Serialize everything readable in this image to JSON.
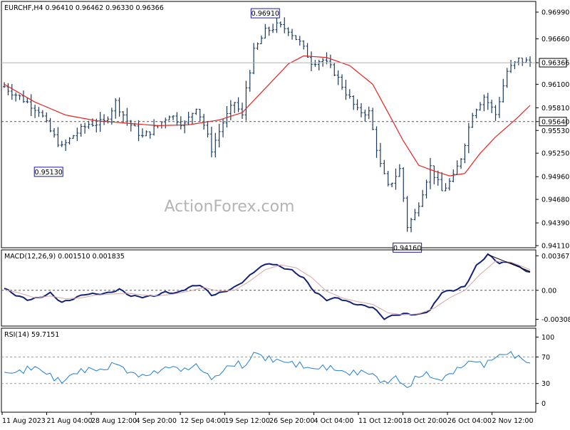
{
  "colors": {
    "background": "#ffffff",
    "border": "#000000",
    "bars": "#1a3a5c",
    "moving_average": "#e8231e",
    "macd_line": "#13217a",
    "macd_signal": "#d6a6a6",
    "rsi_line": "#1f7fd4",
    "trendline": "#000000",
    "dashed_lines": "#555555",
    "label_border": "#1a1aa0"
  },
  "watermark": "ActionForex.com",
  "chart_data": [
    {
      "type": "ohlc",
      "name": "price",
      "header": "EURCHF,H4  0.96410 0.96462 0.96330 0.96366",
      "y_ticks": [
        "0.96990",
        "0.96660",
        "0.96366",
        "0.96100",
        "0.95810",
        "0.95640",
        "0.95530",
        "0.95250",
        "0.94960",
        "0.94680",
        "0.94390",
        "0.94110"
      ],
      "y_tick_values": [
        0.9699,
        0.9666,
        0.96366,
        0.961,
        0.9581,
        0.9564,
        0.9553,
        0.9525,
        0.9496,
        0.9468,
        0.9439,
        0.9411
      ],
      "highlighted_ticks": [
        "0.96366",
        "0.95640"
      ],
      "ylim": [
        0.9411,
        0.9699
      ],
      "current_price": 0.96366,
      "support_level": 0.9564,
      "annotations": [
        {
          "label": "0.96910",
          "value": 0.9691,
          "bar": 68
        },
        {
          "label": "0.95130",
          "value": 0.9513,
          "bar": 16
        },
        {
          "label": "0.94160",
          "value": 0.9416,
          "bar": 105
        }
      ],
      "x_ticks": [
        "11 Aug 2023",
        "21 Aug 04:00",
        "28 Aug 12:00",
        "4 Sep 20:00",
        "12 Sep 04:00",
        "19 Sep 12:00",
        "26 Sep 20:00",
        "4 Oct 04:00",
        "11 Oct 12:00",
        "18 Oct 20:00",
        "26 Oct 04:00",
        "2 Nov 12:00"
      ],
      "close_path": [
        [
          0,
          0.9607
        ],
        [
          5,
          0.9591
        ],
        [
          9,
          0.9578
        ],
        [
          12,
          0.9552
        ],
        [
          15,
          0.9532
        ],
        [
          18,
          0.9547
        ],
        [
          22,
          0.9561
        ],
        [
          26,
          0.9563
        ],
        [
          29,
          0.9588
        ],
        [
          32,
          0.9565
        ],
        [
          36,
          0.9545
        ],
        [
          40,
          0.9559
        ],
        [
          43,
          0.9573
        ],
        [
          47,
          0.956
        ],
        [
          50,
          0.9583
        ],
        [
          52,
          0.956
        ],
        [
          54,
          0.953
        ],
        [
          57,
          0.9563
        ],
        [
          60,
          0.9588
        ],
        [
          62,
          0.957
        ],
        [
          63,
          0.9606
        ],
        [
          65,
          0.965
        ],
        [
          68,
          0.9675
        ],
        [
          71,
          0.9682
        ],
        [
          74,
          0.9678
        ],
        [
          77,
          0.9661
        ],
        [
          80,
          0.9638
        ],
        [
          83,
          0.964
        ],
        [
          86,
          0.9625
        ],
        [
          89,
          0.96
        ],
        [
          92,
          0.9577
        ],
        [
          95,
          0.9575
        ],
        [
          98,
          0.951
        ],
        [
          100,
          0.9483
        ],
        [
          103,
          0.9505
        ],
        [
          105,
          0.9435
        ],
        [
          107,
          0.945
        ],
        [
          109,
          0.9478
        ],
        [
          111,
          0.9508
        ],
        [
          114,
          0.9478
        ],
        [
          117,
          0.9495
        ],
        [
          119,
          0.952
        ],
        [
          122,
          0.9575
        ],
        [
          125,
          0.9595
        ],
        [
          128,
          0.9573
        ],
        [
          131,
          0.9626
        ],
        [
          134,
          0.964
        ],
        [
          137,
          0.9637
        ]
      ],
      "moving_average_path": [
        [
          0,
          0.961
        ],
        [
          8,
          0.9588
        ],
        [
          16,
          0.9572
        ],
        [
          24,
          0.9565
        ],
        [
          32,
          0.9562
        ],
        [
          40,
          0.9559
        ],
        [
          48,
          0.956
        ],
        [
          56,
          0.9566
        ],
        [
          62,
          0.9575
        ],
        [
          68,
          0.9605
        ],
        [
          74,
          0.9635
        ],
        [
          78,
          0.9645
        ],
        [
          84,
          0.9643
        ],
        [
          90,
          0.9633
        ],
        [
          96,
          0.961
        ],
        [
          100,
          0.9575
        ],
        [
          104,
          0.954
        ],
        [
          108,
          0.951
        ],
        [
          112,
          0.9503
        ],
        [
          116,
          0.9497
        ],
        [
          120,
          0.95
        ],
        [
          124,
          0.9525
        ],
        [
          128,
          0.9545
        ],
        [
          134,
          0.957
        ],
        [
          137,
          0.9584
        ]
      ],
      "bar_count": 138
    },
    {
      "type": "line",
      "name": "macd",
      "label": "MACD(12,26,9) 0.001510 0.001835",
      "y_ticks": [
        "0.00367",
        "0.00",
        "-0.00308"
      ],
      "y_tick_values": [
        0.00367,
        0.0,
        -0.00308
      ],
      "ylim": [
        -0.00365,
        0.00392
      ],
      "series": [
        {
          "key": "macd_line",
          "points": [
            [
              0,
              0.0002
            ],
            [
              3,
              -0.0005
            ],
            [
              6,
              -0.001
            ],
            [
              9,
              -0.0008
            ],
            [
              12,
              -0.0003
            ],
            [
              15,
              -0.0013
            ],
            [
              18,
              -0.0009
            ],
            [
              21,
              -0.0004
            ],
            [
              24,
              -0.0004
            ],
            [
              27,
              -0.0003
            ],
            [
              30,
              0.0001
            ],
            [
              33,
              -0.0006
            ],
            [
              36,
              -0.0007
            ],
            [
              39,
              -0.0006
            ],
            [
              42,
              -0.0002
            ],
            [
              45,
              -0.0003
            ],
            [
              48,
              0.0003
            ],
            [
              51,
              0.0006
            ],
            [
              54,
              -0.0005
            ],
            [
              57,
              -0.0002
            ],
            [
              60,
              0.0003
            ],
            [
              63,
              0.0012
            ],
            [
              66,
              0.0023
            ],
            [
              69,
              0.0029
            ],
            [
              72,
              0.0025
            ],
            [
              75,
              0.0021
            ],
            [
              78,
              0.0013
            ],
            [
              81,
              -0.0002
            ],
            [
              84,
              -0.001
            ],
            [
              87,
              -0.0008
            ],
            [
              90,
              -0.0013
            ],
            [
              93,
              -0.0016
            ],
            [
              96,
              -0.0018
            ],
            [
              99,
              -0.003
            ],
            [
              102,
              -0.0026
            ],
            [
              105,
              -0.0025
            ],
            [
              108,
              -0.0026
            ],
            [
              111,
              -0.0021
            ],
            [
              114,
              -0.0002
            ],
            [
              117,
              -0.0
            ],
            [
              120,
              0.0004
            ],
            [
              123,
              0.0026
            ],
            [
              126,
              0.0038
            ],
            [
              129,
              0.0029
            ],
            [
              132,
              0.003
            ],
            [
              134,
              0.0025
            ],
            [
              137,
              0.0019
            ]
          ]
        },
        {
          "key": "macd_signal",
          "points": [
            [
              0,
              0.0001
            ],
            [
              4,
              -0.0003
            ],
            [
              8,
              -0.0008
            ],
            [
              12,
              -0.0006
            ],
            [
              16,
              -0.0009
            ],
            [
              20,
              -0.0008
            ],
            [
              24,
              -0.0005
            ],
            [
              28,
              -0.0004
            ],
            [
              32,
              -0.0003
            ],
            [
              36,
              -0.0005
            ],
            [
              40,
              -0.0006
            ],
            [
              44,
              -0.0004
            ],
            [
              48,
              -0.0001
            ],
            [
              52,
              0.0003
            ],
            [
              56,
              -0.0001
            ],
            [
              60,
              0.0
            ],
            [
              64,
              0.001
            ],
            [
              68,
              0.0022
            ],
            [
              72,
              0.0027
            ],
            [
              76,
              0.0024
            ],
            [
              80,
              0.0014
            ],
            [
              84,
              -0.0001
            ],
            [
              88,
              -0.0008
            ],
            [
              92,
              -0.0012
            ],
            [
              96,
              -0.0015
            ],
            [
              100,
              -0.0024
            ],
            [
              104,
              -0.0026
            ],
            [
              108,
              -0.0025
            ],
            [
              112,
              -0.0019
            ],
            [
              116,
              -0.0008
            ],
            [
              120,
              0.0
            ],
            [
              124,
              0.0017
            ],
            [
              128,
              0.0031
            ],
            [
              132,
              0.003
            ],
            [
              137,
              0.0022
            ]
          ]
        }
      ],
      "trendline": [
        [
          126,
          0.0038
        ],
        [
          137,
          0.002
        ]
      ]
    },
    {
      "type": "line",
      "name": "rsi",
      "label": "RSI(14) 59.7151",
      "y_ticks": [
        "100",
        "70",
        "30",
        "0"
      ],
      "y_tick_values": [
        100,
        70,
        30,
        0
      ],
      "guide_levels": [
        70,
        30
      ],
      "ylim": [
        -10,
        108
      ],
      "series": [
        {
          "key": "rsi_line",
          "points": [
            [
              0,
              45
            ],
            [
              4,
              48
            ],
            [
              8,
              55
            ],
            [
              12,
              42
            ],
            [
              15,
              32
            ],
            [
              18,
              45
            ],
            [
              22,
              52
            ],
            [
              26,
              50
            ],
            [
              29,
              62
            ],
            [
              32,
              48
            ],
            [
              36,
              41
            ],
            [
              40,
              48
            ],
            [
              43,
              56
            ],
            [
              47,
              50
            ],
            [
              50,
              58
            ],
            [
              53,
              42
            ],
            [
              55,
              38
            ],
            [
              58,
              55
            ],
            [
              61,
              60
            ],
            [
              63,
              55
            ],
            [
              65,
              78
            ],
            [
              68,
              68
            ],
            [
              71,
              65
            ],
            [
              74,
              62
            ],
            [
              77,
              58
            ],
            [
              80,
              52
            ],
            [
              84,
              55
            ],
            [
              87,
              50
            ],
            [
              90,
              45
            ],
            [
              93,
              48
            ],
            [
              96,
              44
            ],
            [
              99,
              30
            ],
            [
              102,
              40
            ],
            [
              105,
              22
            ],
            [
              107,
              38
            ],
            [
              110,
              45
            ],
            [
              113,
              34
            ],
            [
              116,
              44
            ],
            [
              119,
              55
            ],
            [
              122,
              65
            ],
            [
              125,
              58
            ],
            [
              128,
              70
            ],
            [
              131,
              76
            ],
            [
              134,
              70
            ],
            [
              137,
              60
            ]
          ]
        }
      ]
    }
  ]
}
